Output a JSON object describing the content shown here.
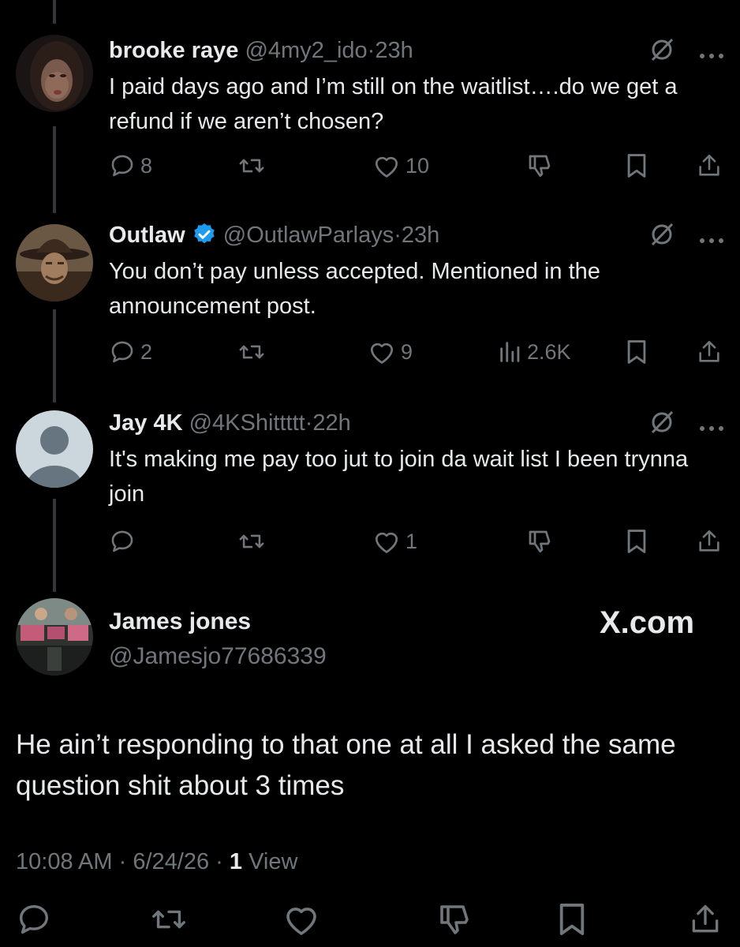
{
  "tweets": [
    {
      "name": "brooke raye",
      "handle": "@4my2_ido",
      "sep": "·",
      "time": "23h",
      "text": "I paid days ago and I’m still on the waitlist….do we get a refund if we aren’t chosen?",
      "replies": "8",
      "likes": "10",
      "verified": false,
      "views": ""
    },
    {
      "name": "Outlaw",
      "handle": "@OutlawParlays",
      "sep": "·",
      "time": "23h",
      "text": "You don’t pay unless accepted. Mentioned in the announcement post.",
      "replies": "2",
      "likes": "9",
      "verified": true,
      "views": "2.6K"
    },
    {
      "name": "Jay 4K",
      "handle": "@4KShittttt",
      "sep": "·",
      "time": "22h",
      "text": "It's making me pay too jut to join da wait list I been trynna join",
      "replies": "",
      "likes": "1",
      "verified": false,
      "views": ""
    }
  ],
  "main_post": {
    "name": "James jones",
    "handle": "@Jamesjo77686339",
    "watermark": "X.com",
    "text": "He ain’t responding to that one at all I asked the same question shit about 3 times",
    "time": "10:08 AM",
    "date": "6/24/26",
    "sep": "·",
    "views_count": "1",
    "views_label": "View"
  },
  "colors": {
    "background": "#000000",
    "text": "#e7e9ea",
    "muted": "#71767b",
    "verified": "#1d9bf0",
    "thread_line": "#333639"
  },
  "icons": [
    "reply-icon",
    "repost-icon",
    "like-icon",
    "dislike-icon",
    "views-icon",
    "bookmark-icon",
    "share-icon",
    "grok-icon",
    "more-icon",
    "verified-icon"
  ]
}
